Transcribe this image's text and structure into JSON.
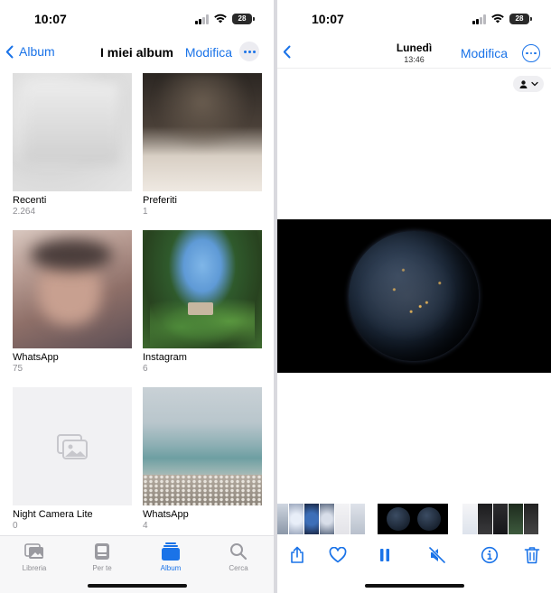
{
  "left_screen": {
    "status": {
      "time": "10:07",
      "battery": "28"
    },
    "nav": {
      "back_label": "Album",
      "title": "I miei album",
      "edit_label": "Modifica"
    },
    "albums": [
      {
        "name": "Recenti",
        "count": "2.264"
      },
      {
        "name": "Preferiti",
        "count": "1"
      },
      {
        "name": "WhatsApp",
        "count": "75"
      },
      {
        "name": "Instagram",
        "count": "6"
      },
      {
        "name": "Night Camera Lite",
        "count": "0"
      },
      {
        "name": "WhatsApp",
        "count": "4"
      }
    ],
    "tabs": [
      {
        "label": "Libreria",
        "icon": "photos-icon"
      },
      {
        "label": "Per te",
        "icon": "for-you-icon"
      },
      {
        "label": "Album",
        "icon": "album-icon",
        "active": true
      },
      {
        "label": "Cerca",
        "icon": "search-icon"
      }
    ]
  },
  "right_screen": {
    "status": {
      "time": "10:07",
      "battery": "28"
    },
    "nav": {
      "day": "Lunedì",
      "hour": "13:46",
      "edit_label": "Modifica"
    },
    "toolbar": [
      "share-icon",
      "heart-icon",
      "pause-icon",
      "mute-icon",
      "info-icon",
      "trash-icon"
    ]
  },
  "colors": {
    "accent": "#1a73e8",
    "secondary_text": "#8e8e93"
  }
}
